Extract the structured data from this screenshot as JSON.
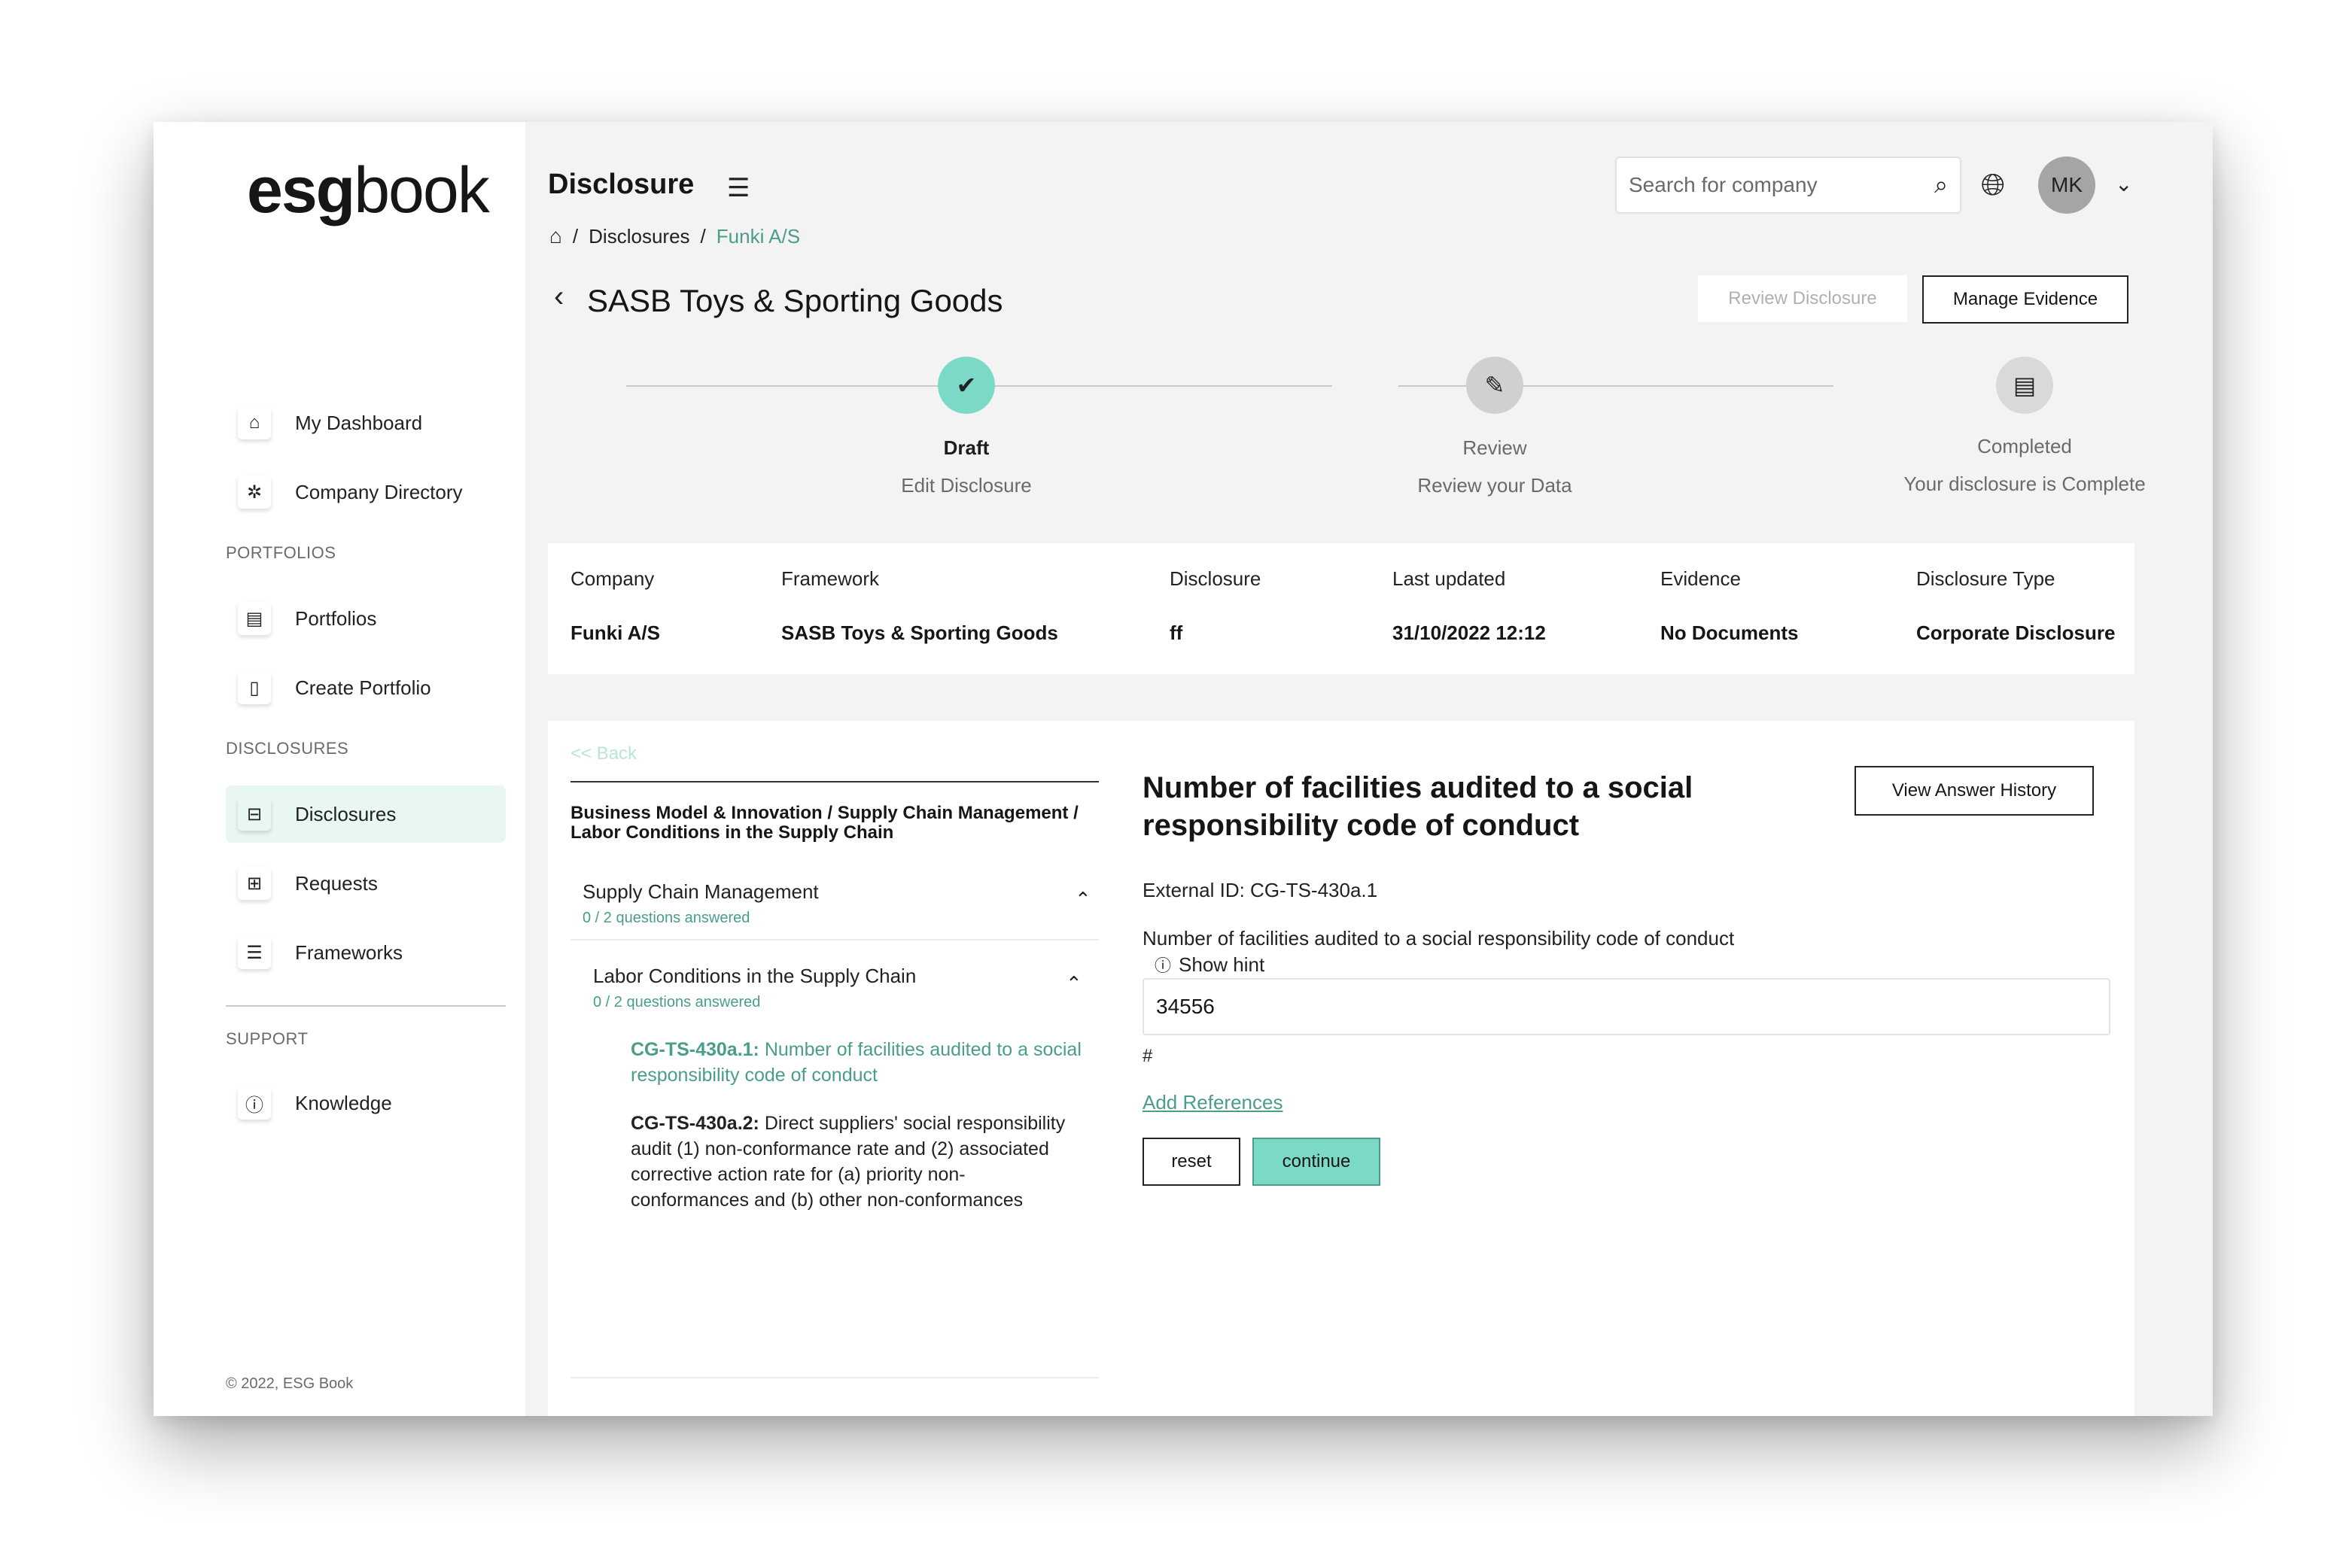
{
  "app": {
    "logo_bold_1": "esg",
    "logo_bold_2": "book",
    "copyright": "© 2022, ESG Book"
  },
  "sidebar": {
    "items": [
      {
        "label": "My Dashboard",
        "icon": "home-icon"
      },
      {
        "label": "Company Directory",
        "icon": "network-icon"
      }
    ],
    "portfolios_label": "PORTFOLIOS",
    "portfolio_items": [
      {
        "label": "Portfolios",
        "icon": "folder-icon"
      },
      {
        "label": "Create Portfolio",
        "icon": "file-icon"
      }
    ],
    "disclosures_label": "DISCLOSURES",
    "disclosure_items": [
      {
        "label": "Disclosures",
        "icon": "inbox-icon",
        "active": true
      },
      {
        "label": "Requests",
        "icon": "request-icon"
      },
      {
        "label": "Frameworks",
        "icon": "stack-icon"
      }
    ],
    "support_label": "SUPPORT",
    "support_items": [
      {
        "label": "Knowledge",
        "icon": "info-circle-icon"
      }
    ]
  },
  "header": {
    "title": "Disclosure",
    "search_placeholder": "Search for company",
    "avatar_initials": "MK"
  },
  "breadcrumb": {
    "items": [
      "Disclosures",
      "Funki A/S"
    ]
  },
  "disclosure": {
    "title": "SASB Toys & Sporting Goods",
    "review_button": "Review Disclosure",
    "manage_evidence_button": "Manage Evidence"
  },
  "stepper": {
    "steps": [
      {
        "title": "Draft",
        "subtitle": "Edit Disclosure",
        "state": "done"
      },
      {
        "title": "Review",
        "subtitle": "Review your Data",
        "state": "pending"
      },
      {
        "title": "Completed",
        "subtitle": "Your disclosure is Complete",
        "state": "pending"
      }
    ]
  },
  "info": {
    "columns": [
      {
        "label": "Company",
        "value": "Funki A/S"
      },
      {
        "label": "Framework",
        "value": "SASB Toys & Sporting Goods"
      },
      {
        "label": "Disclosure",
        "value": "ff"
      },
      {
        "label": "Last updated",
        "value": "31/10/2022 12:12"
      },
      {
        "label": "Evidence",
        "value": "No Documents"
      },
      {
        "label": "Disclosure Type",
        "value": "Corporate Disclosure"
      }
    ]
  },
  "questions_panel": {
    "back_link": "<< Back",
    "category_path": "Business Model & Innovation / Supply Chain Management / Labor Conditions in the Supply Chain",
    "group1": {
      "title": "Supply Chain Management",
      "sub": "0 / 2 questions answered"
    },
    "group2": {
      "title": "Labor Conditions in the Supply Chain",
      "sub": "0 / 2 questions answered"
    },
    "questions": [
      {
        "id": "CG-TS-430a.1:",
        "text": " Number of facilities audited to a social responsibility code of conduct"
      },
      {
        "id": "CG-TS-430a.2:",
        "text": " Direct suppliers' social responsibility audit (1) non-conformance rate and (2) associated corrective action rate for (a) priority non-conformances and (b) other non-conformances"
      }
    ]
  },
  "question_detail": {
    "title": "Number of facilities audited to a social responsibility code of conduct",
    "history_button": "View Answer History",
    "external_id": "External ID: CG-TS-430a.1",
    "label": "Number of facilities audited to a social responsibility code of conduct",
    "hint": "Show hint",
    "answer_value": "34556",
    "unit": "#",
    "add_references": "Add References",
    "reset_button": "reset",
    "continue_button": "continue"
  },
  "colors": {
    "accent": "#7dd9c7",
    "accent_text": "#4a9d8b",
    "active_bg": "#e8f7f3"
  }
}
